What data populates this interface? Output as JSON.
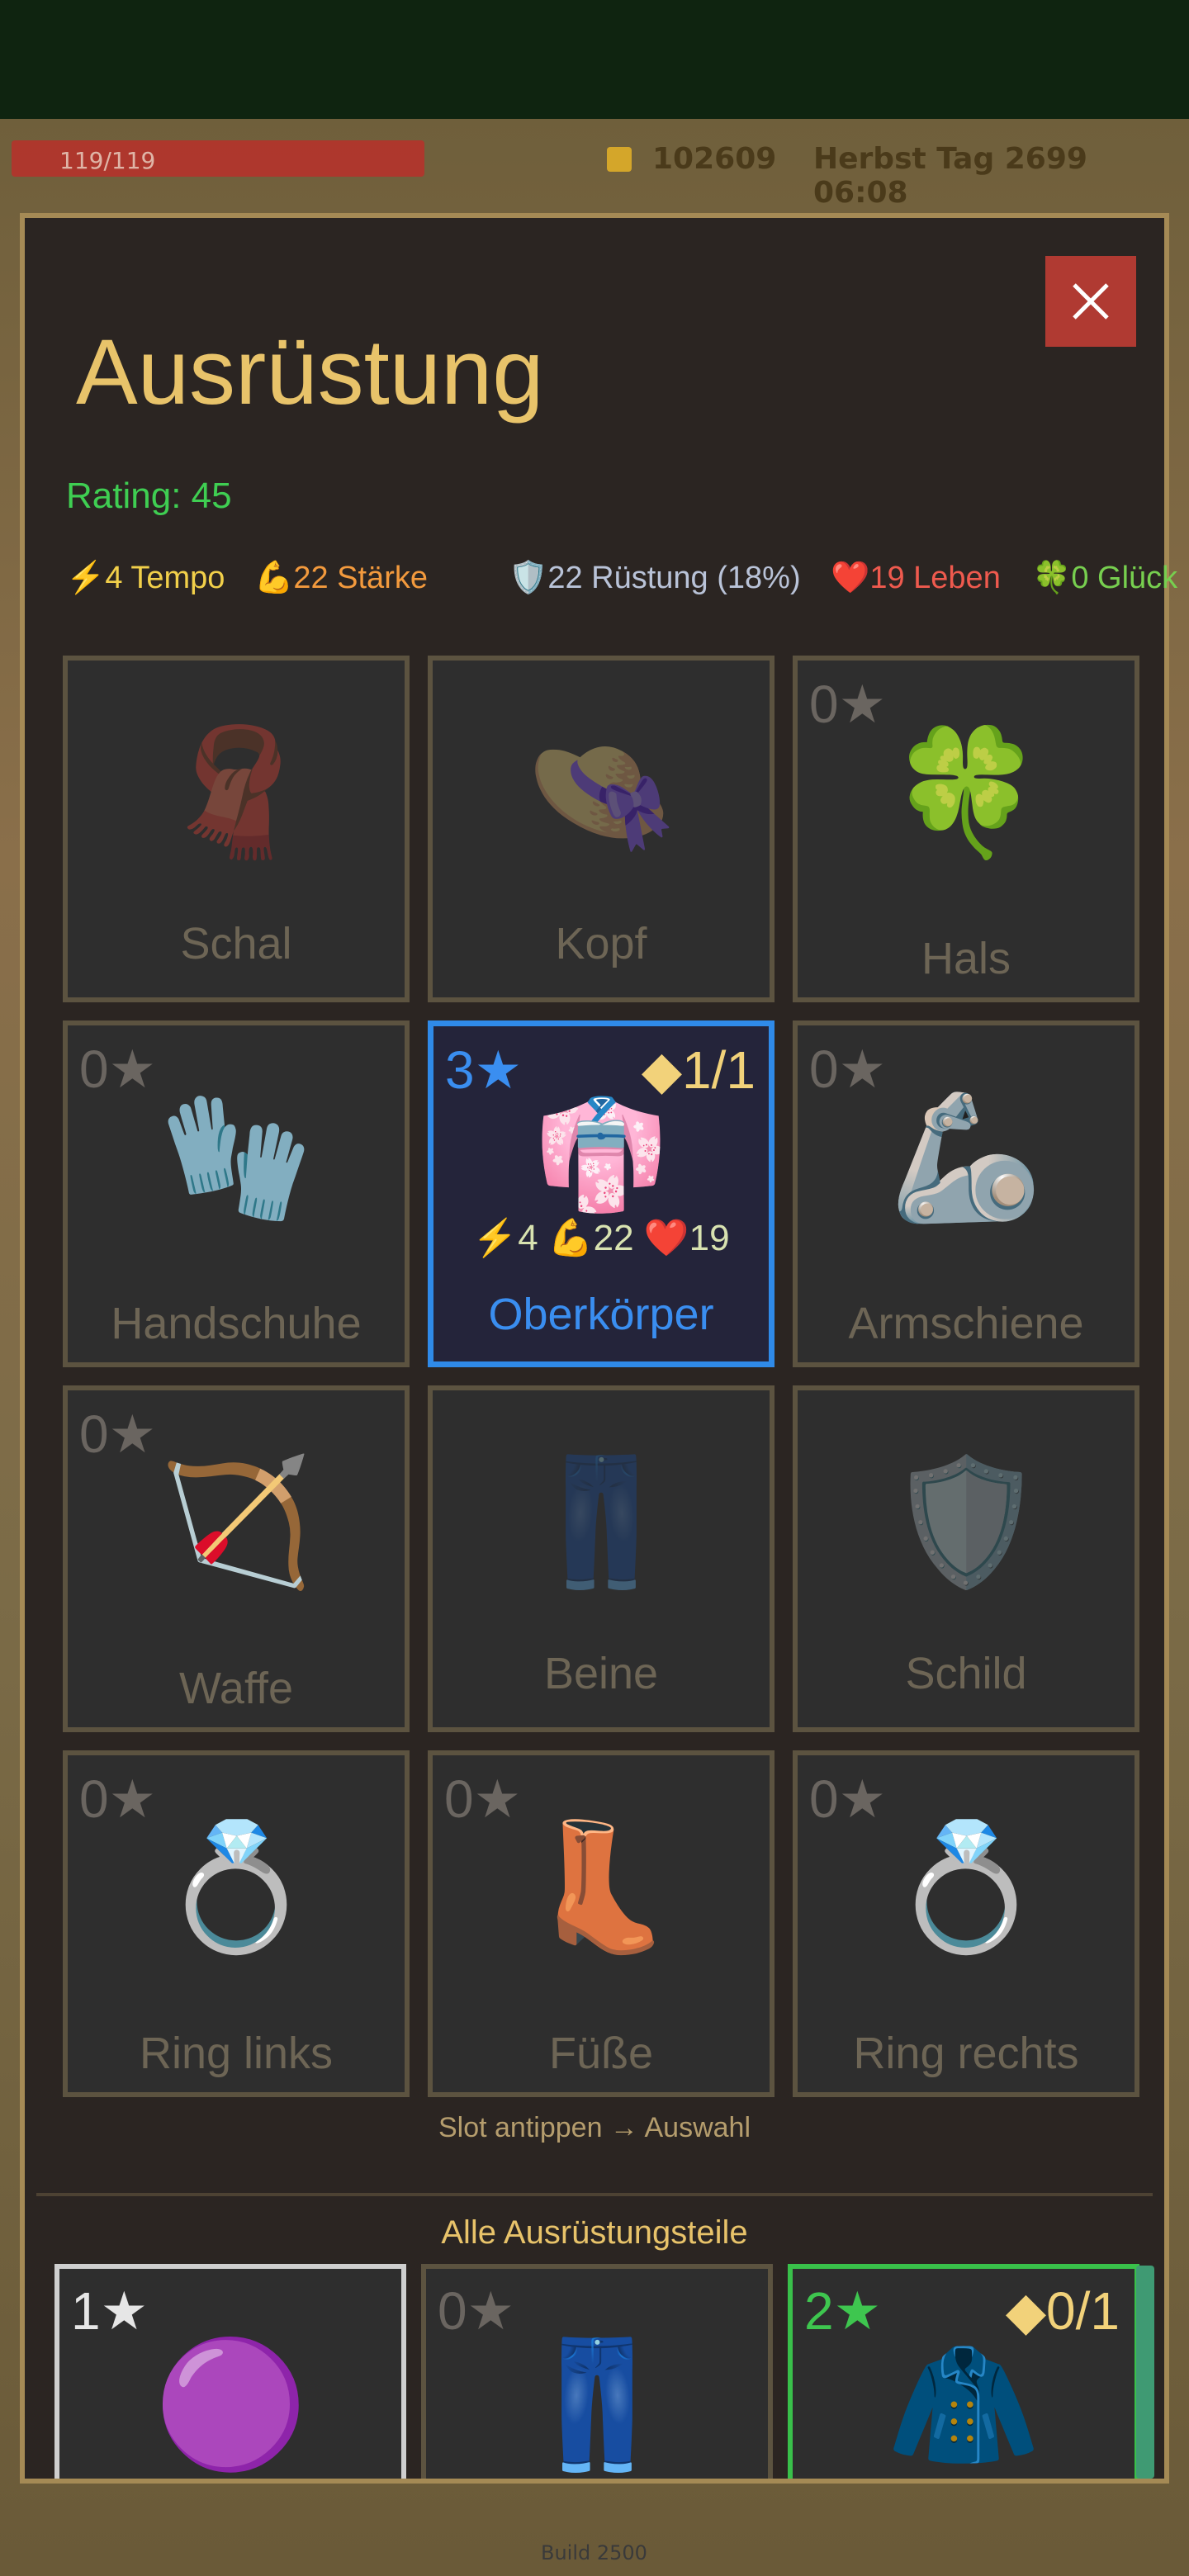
{
  "hud": {
    "hp": "119/119",
    "gold": "102609",
    "date": "Herbst  Tag 2699  06:08",
    "build": "Build 2500"
  },
  "modal": {
    "title": "Ausrüstung",
    "rating": "Rating: 45",
    "stats": {
      "tempo": {
        "icon": "⚡",
        "text": "4 Tempo"
      },
      "staerke": {
        "icon": "💪",
        "text": "22 Stärke"
      },
      "ruestung": {
        "icon": "🛡️",
        "text": "22 Rüstung (18%)"
      },
      "leben": {
        "icon": "❤️",
        "text": "19 Leben"
      },
      "glueck": {
        "icon": "🍀",
        "text": "0 Glück"
      }
    },
    "slots": [
      {
        "label": "Schal",
        "stars": "",
        "art": "🧣",
        "dim": true
      },
      {
        "label": "Kopf",
        "stars": "",
        "art": "👒",
        "dim": true
      },
      {
        "label": "Hals",
        "stars": "0★",
        "art": "🍀",
        "dim": false
      },
      {
        "label": "Handschuhe",
        "stars": "0★",
        "art": "🧤",
        "dim": false
      },
      {
        "label": "Oberkörper",
        "stars": "3★",
        "gems": "◆1/1",
        "art": "👘",
        "mini": "⚡4 💪22 ❤️19",
        "selected": true
      },
      {
        "label": "Armschiene",
        "stars": "0★",
        "art": "🦾",
        "dim": false
      },
      {
        "label": "Waffe",
        "stars": "0★",
        "art": "🏹",
        "dim": false
      },
      {
        "label": "Beine",
        "stars": "",
        "art": "👖",
        "dim": true
      },
      {
        "label": "Schild",
        "stars": "",
        "art": "🛡️",
        "dim": true
      },
      {
        "label": "Ring links",
        "stars": "0★",
        "art": "💍",
        "dim": false
      },
      {
        "label": "Füße",
        "stars": "0★",
        "art": "👢",
        "dim": false
      },
      {
        "label": "Ring rechts",
        "stars": "0★",
        "art": "💍",
        "dim": false
      }
    ],
    "hint": "Slot antippen → Auswahl",
    "all_items_title": "Alle Ausrüstungsteile",
    "items": [
      {
        "stars": "1★",
        "gems": "",
        "art": "🟣"
      },
      {
        "stars": "0★",
        "gems": "",
        "art": "👖"
      },
      {
        "stars": "2★",
        "gems": "◆0/1",
        "art": "🧥"
      }
    ]
  },
  "icons": {
    "close": "close-icon"
  }
}
